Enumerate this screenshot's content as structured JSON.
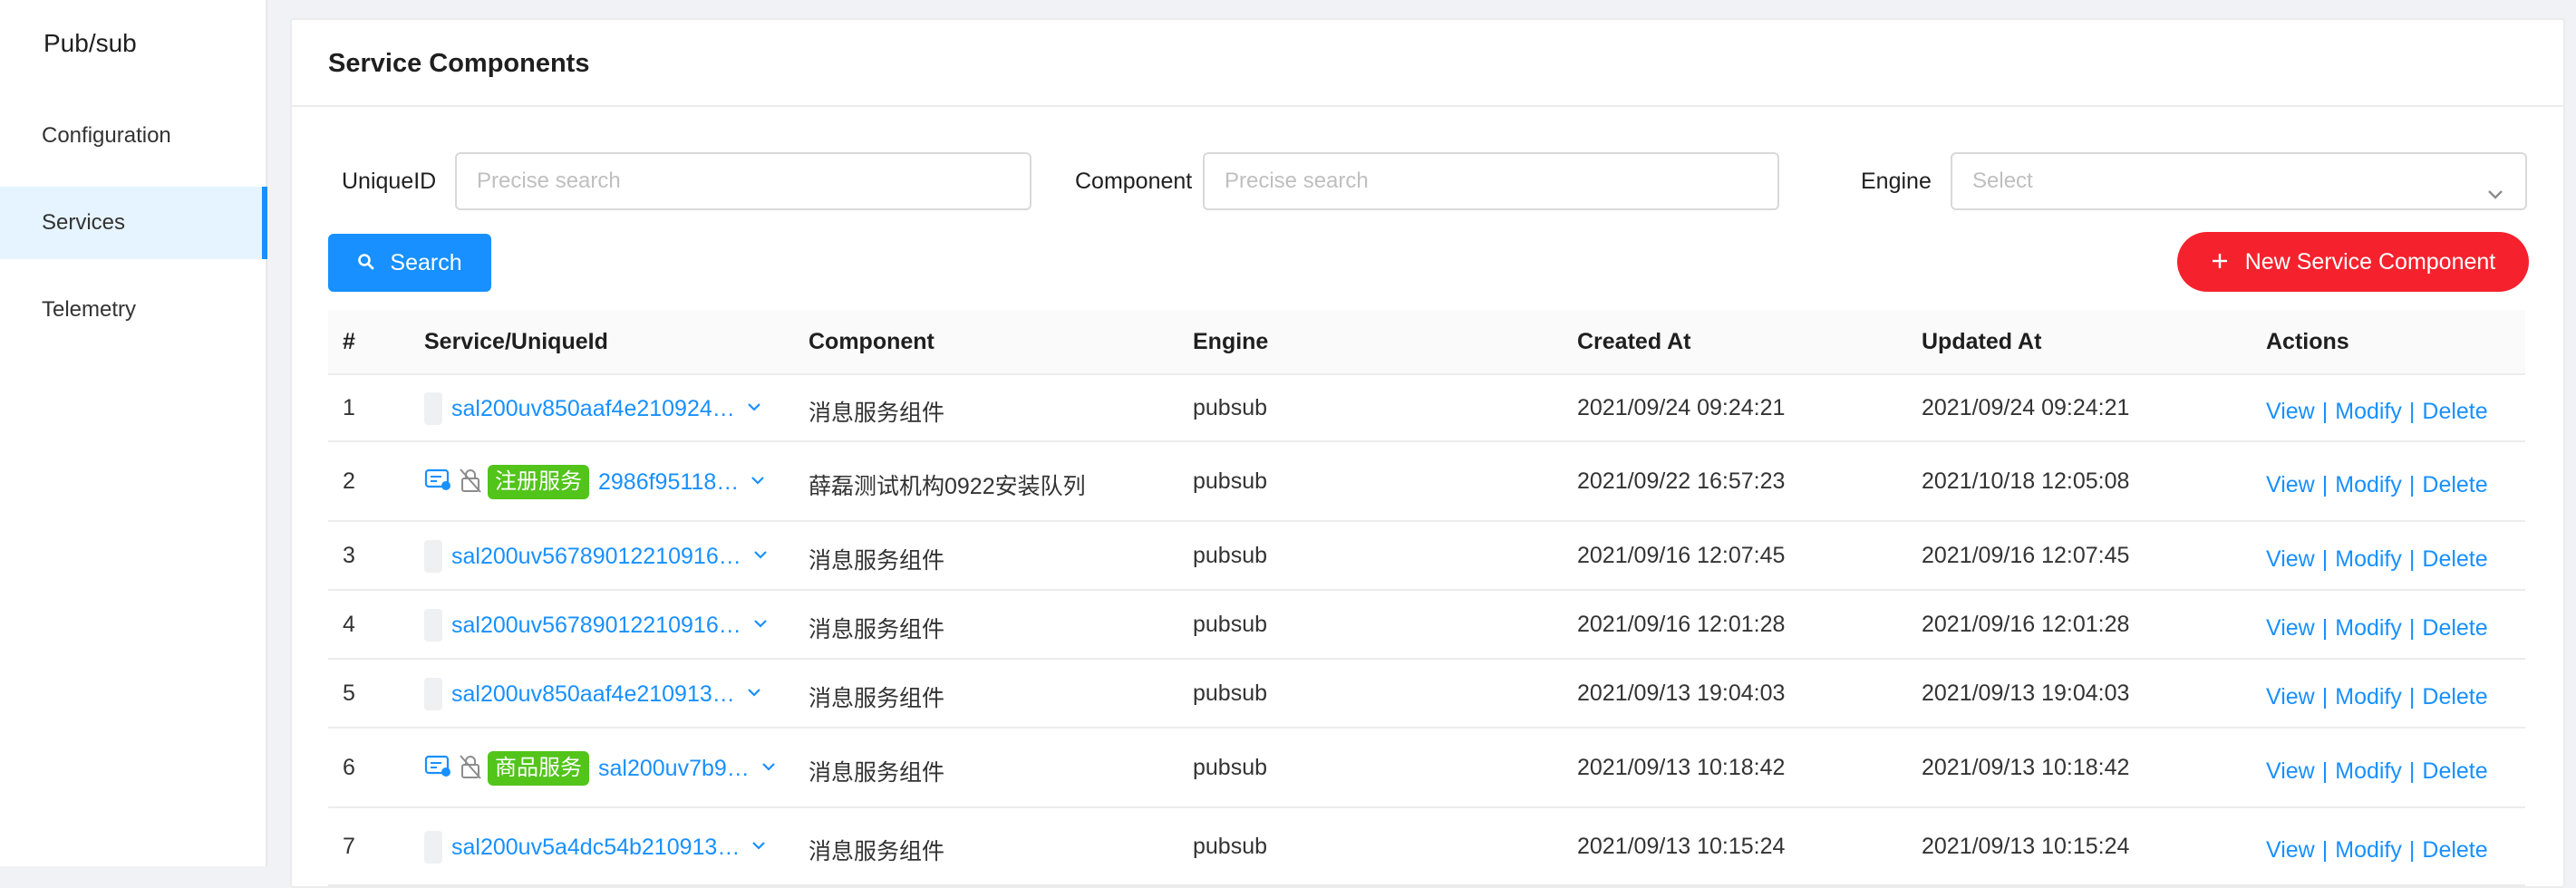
{
  "sidebar": {
    "brand": "Pub/sub",
    "items": [
      {
        "label": "Configuration"
      },
      {
        "label": "Services"
      },
      {
        "label": "Telemetry"
      }
    ]
  },
  "card": {
    "title": "Service Components"
  },
  "filters": {
    "uniqueid_label": "UniqueID",
    "uniqueid_placeholder": "Precise search",
    "component_label": "Component",
    "component_placeholder": "Precise search",
    "engine_label": "Engine",
    "engine_placeholder": "Select"
  },
  "buttons": {
    "search": "Search",
    "new_component": "New Service Component"
  },
  "table": {
    "headers": [
      "#",
      "Service/UniqueId",
      "Component",
      "Engine",
      "Created At",
      "Updated At",
      "Actions"
    ],
    "rows": [
      {
        "num": "1",
        "tag": "",
        "uid": "sal200uv850aaf4e210924…",
        "component": "消息服务组件",
        "engine": "pubsub",
        "created": "2021/09/24 09:24:21",
        "updated": "2021/09/24 09:24:21"
      },
      {
        "num": "2",
        "tag": "注册服务",
        "uid": "2986f95118…",
        "component": "薛磊测试机构0922安装队列",
        "engine": "pubsub",
        "created": "2021/09/22 16:57:23",
        "updated": "2021/10/18 12:05:08"
      },
      {
        "num": "3",
        "tag": "",
        "uid": "sal200uv56789012210916…",
        "component": "消息服务组件",
        "engine": "pubsub",
        "created": "2021/09/16 12:07:45",
        "updated": "2021/09/16 12:07:45"
      },
      {
        "num": "4",
        "tag": "",
        "uid": "sal200uv56789012210916…",
        "component": "消息服务组件",
        "engine": "pubsub",
        "created": "2021/09/16 12:01:28",
        "updated": "2021/09/16 12:01:28"
      },
      {
        "num": "5",
        "tag": "",
        "uid": "sal200uv850aaf4e210913…",
        "component": "消息服务组件",
        "engine": "pubsub",
        "created": "2021/09/13 19:04:03",
        "updated": "2021/09/13 19:04:03"
      },
      {
        "num": "6",
        "tag": "商品服务",
        "uid": "sal200uv7b9…",
        "component": "消息服务组件",
        "engine": "pubsub",
        "created": "2021/09/13 10:18:42",
        "updated": "2021/09/13 10:18:42"
      },
      {
        "num": "7",
        "tag": "",
        "uid": "sal200uv5a4dc54b210913…",
        "component": "消息服务组件",
        "engine": "pubsub",
        "created": "2021/09/13 10:15:24",
        "updated": "2021/09/13 10:15:24"
      }
    ],
    "actions": {
      "view": "View",
      "modify": "Modify",
      "delete": "Delete",
      "separator": "|"
    }
  },
  "colors": {
    "primary": "#1890ff",
    "danger": "#f5222d",
    "tag_green": "#52c41a"
  },
  "icons": {
    "search": "search-icon",
    "plus": "plus-icon",
    "chevron": "chevron-down-icon",
    "service_card": "service-card-icon",
    "lock_off": "lock-off-icon"
  }
}
